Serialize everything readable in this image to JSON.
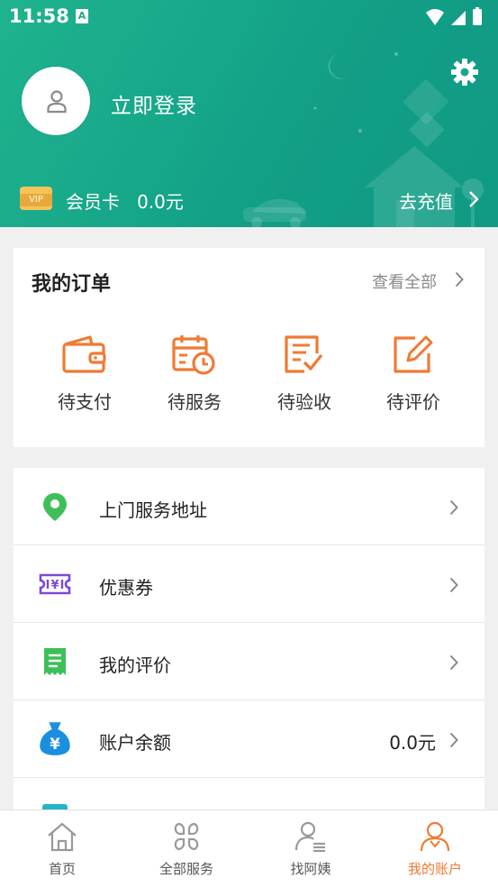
{
  "status_bar": {
    "time": "11:58",
    "notification_icon": "A"
  },
  "header": {
    "login_label": "立即登录",
    "vip_badge": "VIP",
    "member_label": "会员卡",
    "member_balance": "0.0元",
    "recharge_label": "去充值"
  },
  "orders": {
    "title": "我的订单",
    "view_all": "查看全部",
    "items": [
      {
        "label": "待支付",
        "icon": "wallet-icon"
      },
      {
        "label": "待服务",
        "icon": "calendar-clock-icon"
      },
      {
        "label": "待验收",
        "icon": "checklist-icon"
      },
      {
        "label": "待评价",
        "icon": "edit-icon"
      }
    ],
    "accent_color": "#f07a33"
  },
  "menu": {
    "items": [
      {
        "label": "上门服务地址",
        "icon": "location-pin-icon",
        "value": ""
      },
      {
        "label": "优惠券",
        "icon": "coupon-icon",
        "value": ""
      },
      {
        "label": "我的评价",
        "icon": "review-doc-icon",
        "value": ""
      },
      {
        "label": "账户余额",
        "icon": "money-bag-icon",
        "value": "0.0元"
      }
    ]
  },
  "tabbar": {
    "tabs": [
      {
        "label": "首页",
        "icon": "home-icon",
        "active": false
      },
      {
        "label": "全部服务",
        "icon": "grid-icon",
        "active": false
      },
      {
        "label": "找阿姨",
        "icon": "person-list-icon",
        "active": false
      },
      {
        "label": "我的账户",
        "icon": "user-account-icon",
        "active": true
      }
    ],
    "active_color": "#f07a33"
  },
  "colors": {
    "header_green": "#17a88a",
    "accent_orange": "#f07a33"
  }
}
